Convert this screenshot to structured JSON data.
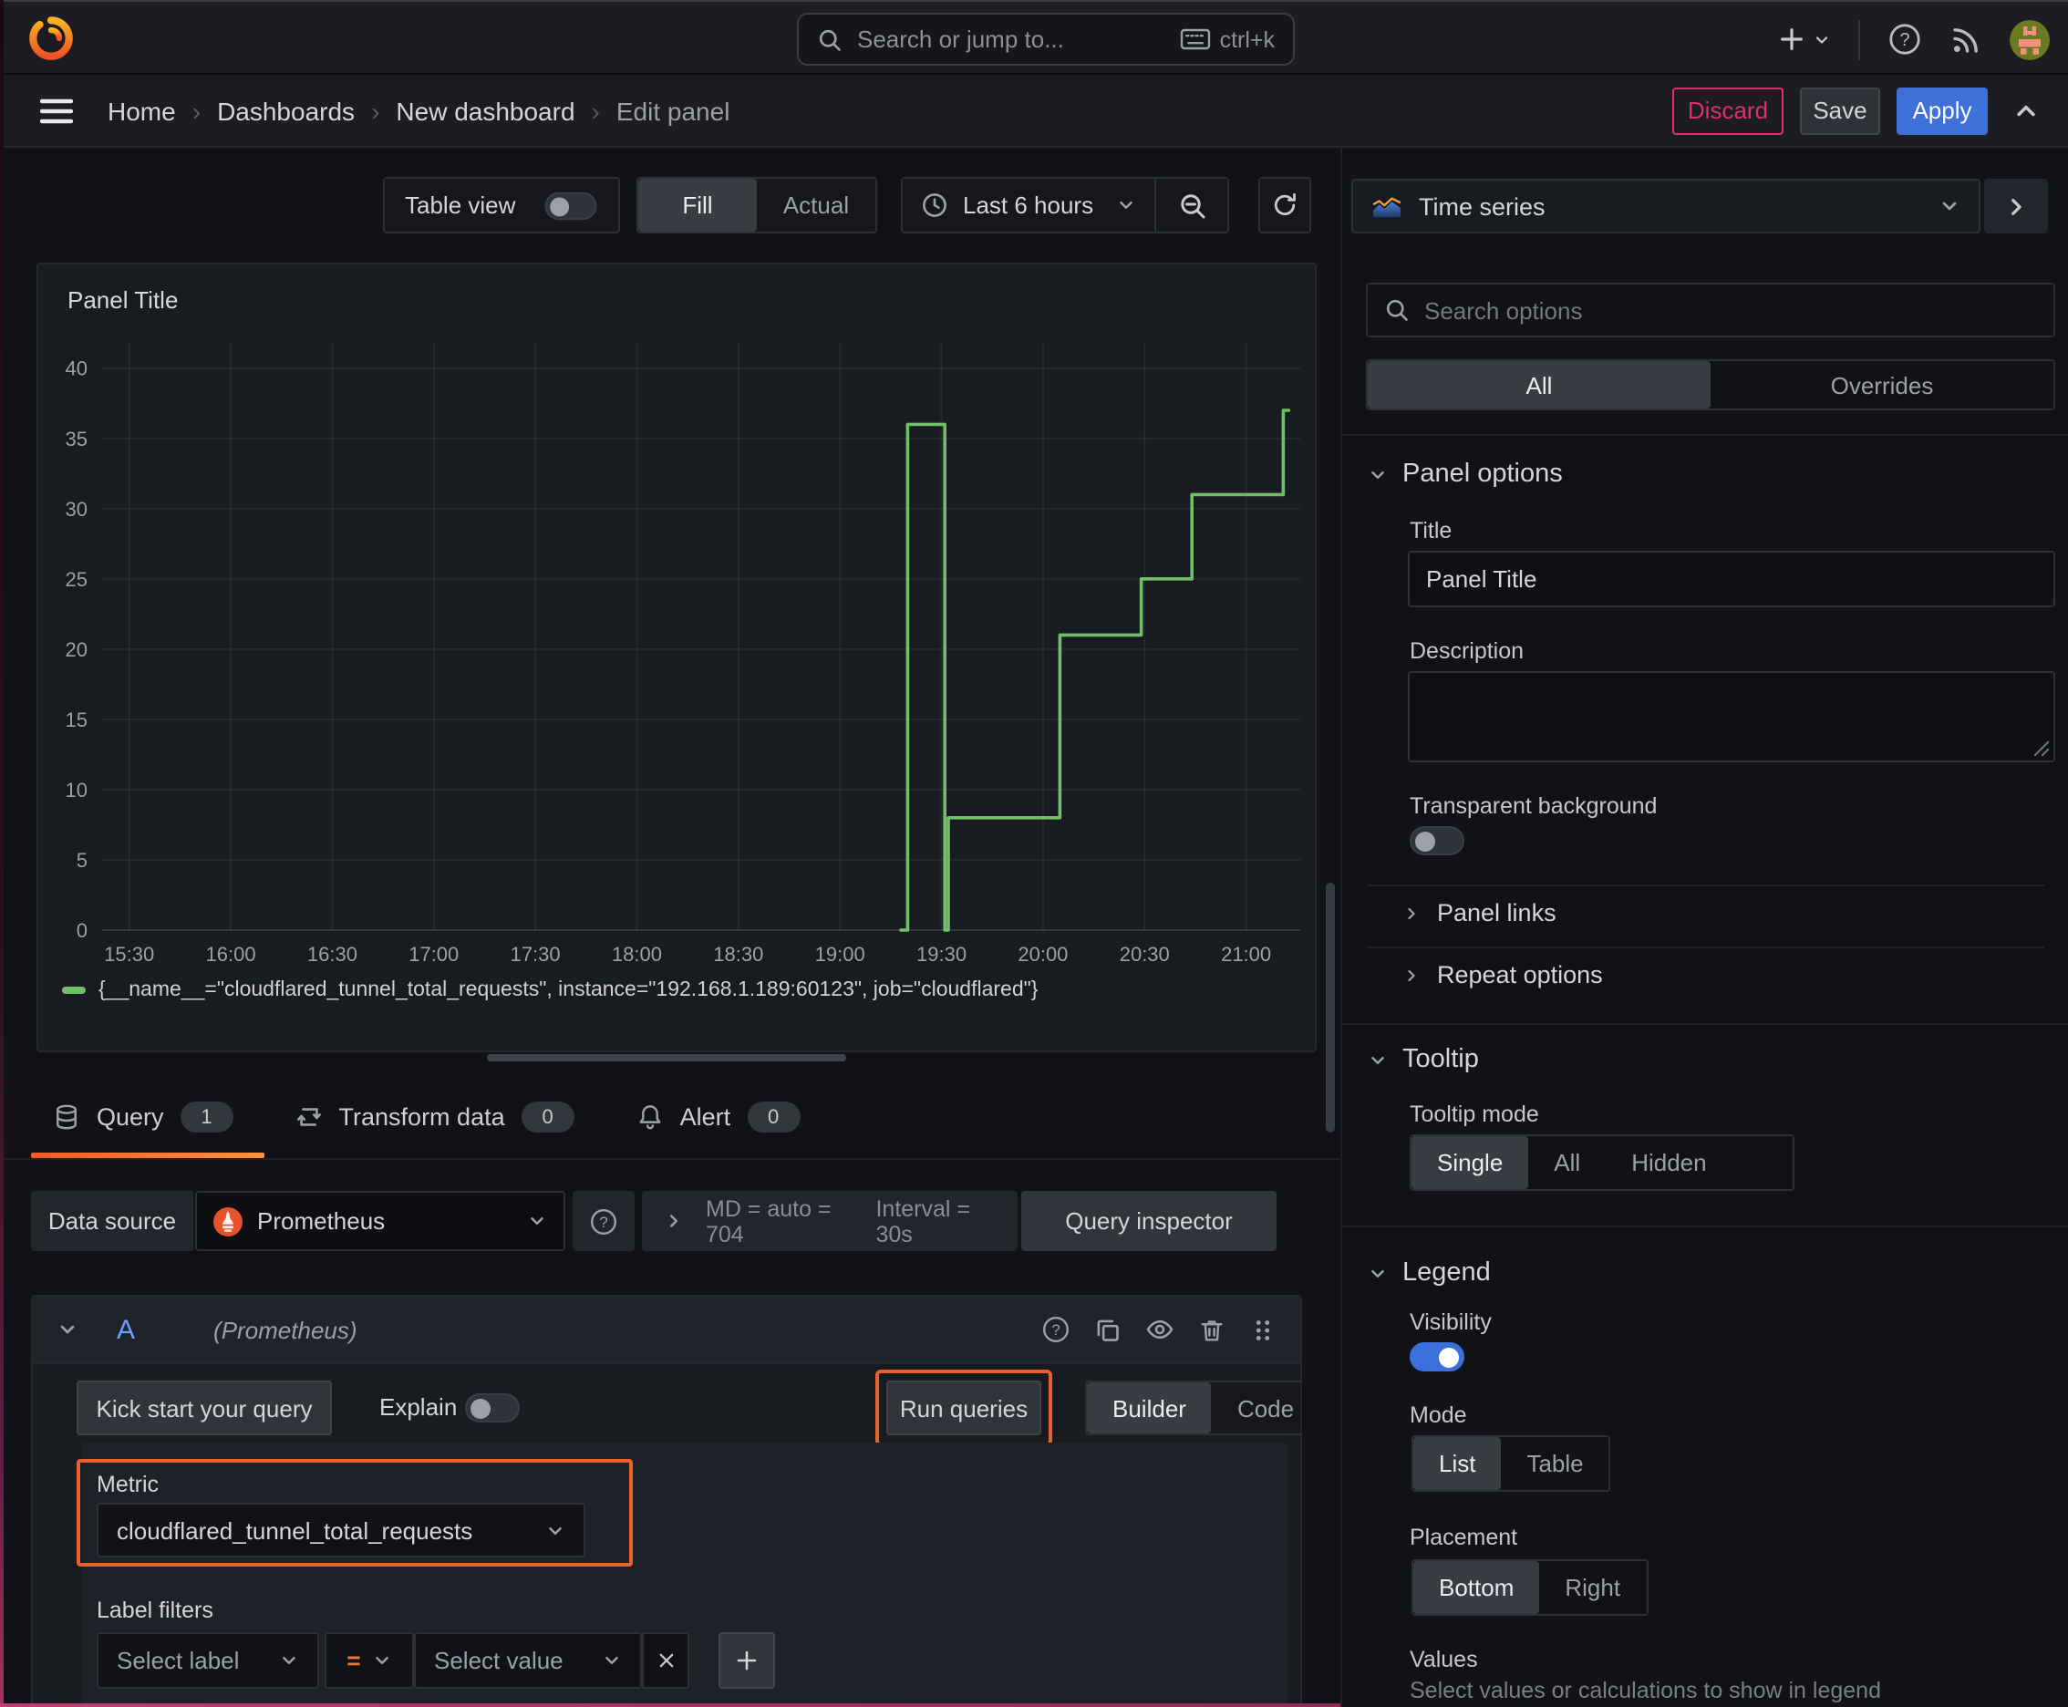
{
  "topbar": {
    "search_placeholder": "Search or jump to...",
    "shortcut": "ctrl+k"
  },
  "navbar": {
    "breadcrumbs": [
      "Home",
      "Dashboards",
      "New dashboard",
      "Edit panel"
    ],
    "separator": "›",
    "discard": "Discard",
    "save": "Save",
    "apply": "Apply"
  },
  "toolbar": {
    "table_view": "Table view",
    "fill": "Fill",
    "actual": "Actual",
    "time_range": "Last 6 hours"
  },
  "panel": {
    "title": "Panel Title"
  },
  "chart_data": {
    "type": "line",
    "variant": "step-after",
    "title": "Panel Title",
    "xlabel": "",
    "ylabel": "",
    "grid": true,
    "legend_position": "bottom",
    "x_ticks": [
      "15:30",
      "16:00",
      "16:30",
      "17:00",
      "17:30",
      "18:00",
      "18:30",
      "19:00",
      "19:30",
      "20:00",
      "20:30",
      "21:00"
    ],
    "y_ticks": [
      0,
      5,
      10,
      15,
      20,
      25,
      30,
      35,
      40
    ],
    "ylim": [
      0,
      41.8
    ],
    "x_domain": [
      "15:22",
      "21:16"
    ],
    "series": [
      {
        "name": "{__name__=\"cloudflared_tunnel_total_requests\", instance=\"192.168.1.189:60123\", job=\"cloudflared\"}",
        "color": "#73bf69",
        "points": [
          [
            "19:18",
            0
          ],
          [
            "19:20",
            36
          ],
          [
            "19:31",
            0
          ],
          [
            "19:32",
            8
          ],
          [
            "20:05",
            21
          ],
          [
            "20:29",
            25
          ],
          [
            "20:44",
            31
          ],
          [
            "21:11",
            37
          ]
        ]
      }
    ]
  },
  "editor_tabs": [
    {
      "label": "Query",
      "count": "1"
    },
    {
      "label": "Transform data",
      "count": "0"
    },
    {
      "label": "Alert",
      "count": "0"
    }
  ],
  "datasource": {
    "label": "Data source",
    "name": "Prometheus",
    "stats": "MD = auto = 704",
    "interval": "Interval = 30s",
    "inspector": "Query inspector"
  },
  "query": {
    "ref": "A",
    "ds_hint": "(Prometheus)",
    "kick_start": "Kick start your query",
    "explain": "Explain",
    "run": "Run queries",
    "builder": "Builder",
    "code": "Code",
    "metric_label": "Metric",
    "metric_value": "cloudflared_tunnel_total_requests",
    "filters_label": "Label filters",
    "select_label": "Select label",
    "op": "=",
    "select_value": "Select value"
  },
  "options": {
    "visualization": "Time series",
    "search_placeholder": "Search options",
    "tabs": {
      "all": "All",
      "overrides": "Overrides"
    },
    "panel_options": {
      "title": "Panel options",
      "title_label": "Title",
      "title_value": "Panel Title",
      "description_label": "Description",
      "transparent_label": "Transparent background"
    },
    "collapsed": [
      {
        "label": "Panel links"
      },
      {
        "label": "Repeat options"
      }
    ],
    "tooltip": {
      "title": "Tooltip",
      "mode_label": "Tooltip mode",
      "modes": [
        "Single",
        "All",
        "Hidden"
      ],
      "selected": "Single"
    },
    "legend": {
      "title": "Legend",
      "visibility_label": "Visibility",
      "mode_label": "Mode",
      "modes": [
        "List",
        "Table"
      ],
      "selected_mode": "List",
      "placement_label": "Placement",
      "placements": [
        "Bottom",
        "Right"
      ],
      "selected_placement": "Bottom",
      "values_label": "Values",
      "values_desc": "Select values or calculations to show in legend"
    }
  },
  "colors": {
    "highlight_orange": "#e8622d",
    "tab_underline": "#f05a28",
    "series_green": "#73bf69",
    "apply_blue": "#3d71d9",
    "discard_pink": "#e02f6f",
    "prometheus_orange": "#e6522c"
  }
}
